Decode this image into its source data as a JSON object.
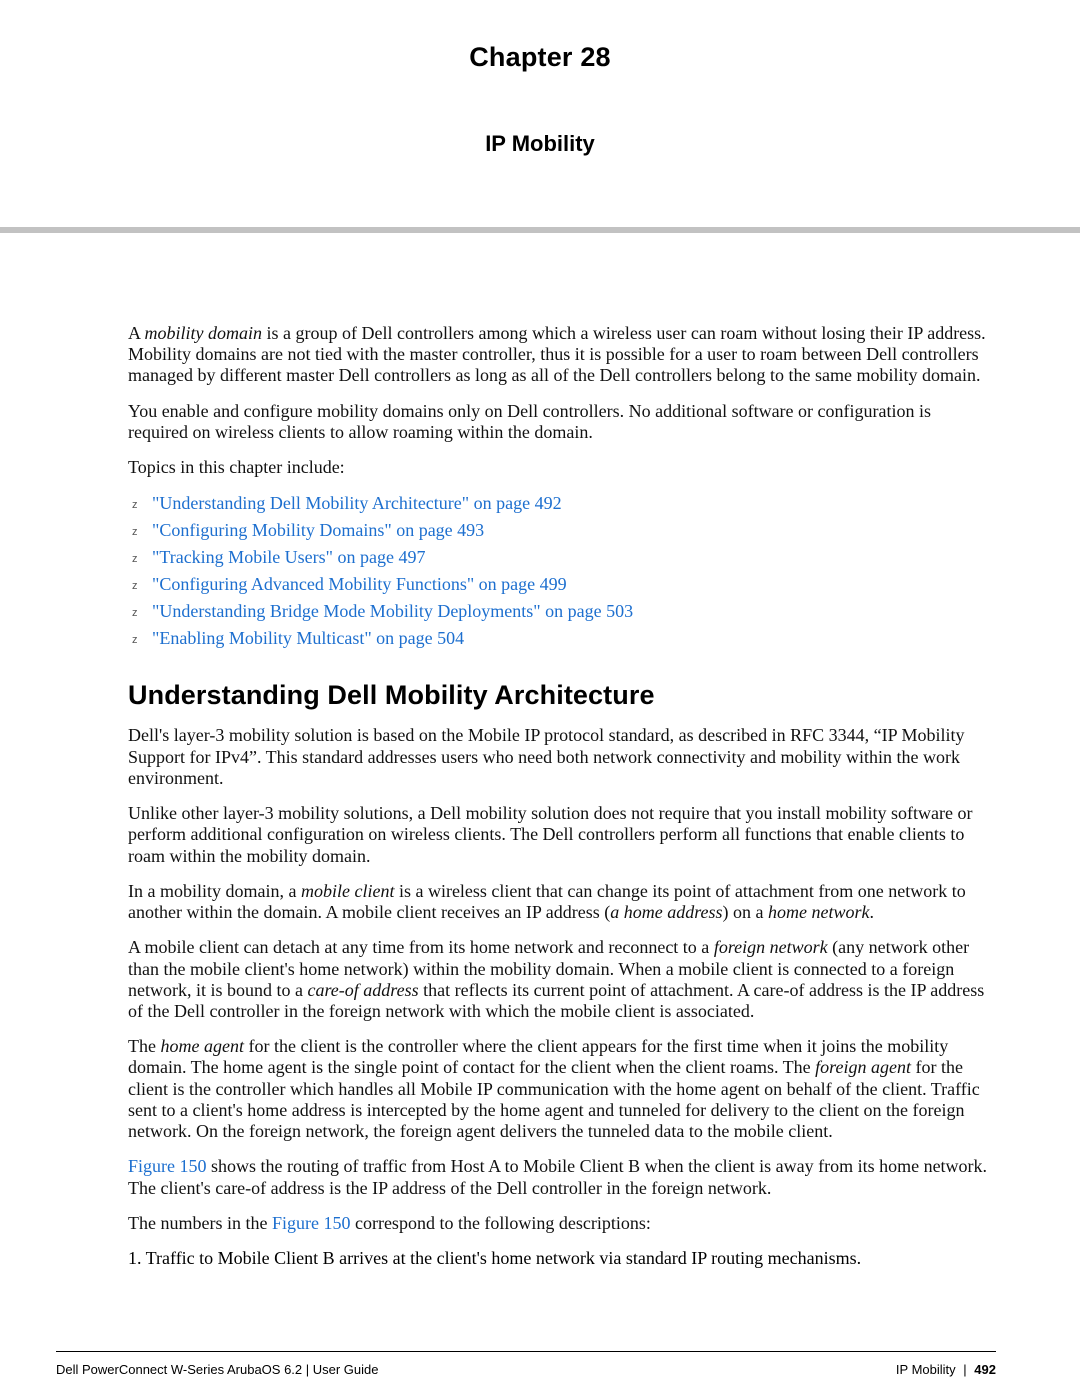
{
  "header": {
    "chapter": "Chapter 28",
    "subject": "IP Mobility"
  },
  "intro": {
    "p1_pre": "A ",
    "p1_ital": "mobility domain",
    "p1_post": " is a group of  Dell controllers among which a wireless user can roam without losing their IP address. Mobility domains are not tied with the master controller, thus it is possible for a user to roam between Dell controllers managed by different master Dell controllers as long as all of the Dell controllers belong to the same mobility domain.",
    "p2": "You enable and configure mobility domains only on  Dell controllers. No additional software or configuration is required on wireless clients to allow roaming within the domain.",
    "topics_label": "Topics in this chapter include:"
  },
  "topics": [
    "\"Understanding Dell Mobility Architecture\" on page 492",
    "\"Configuring Mobility Domains\" on page 493",
    "\"Tracking Mobile Users\" on page 497",
    "\"Configuring Advanced Mobility Functions\" on page 499",
    "\"Understanding Bridge Mode Mobility Deployments\" on page 503",
    "\"Enabling Mobility Multicast\" on page 504"
  ],
  "section": {
    "heading": "Understanding Dell Mobility Architecture",
    "p1": "Dell's layer-3 mobility solution is based on the Mobile IP protocol standard, as described in RFC 3344, “IP Mobility Support for IPv4”. This standard addresses users who need both network connectivity and mobility within the work environment.",
    "p2": "Unlike other layer-3 mobility solutions, a  Dell mobility solution does not require that you install mobility software or perform additional configuration on wireless clients. The Dell controllers perform all functions that enable clients to roam within the mobility domain.",
    "p3": {
      "a": "In a mobility domain, a ",
      "b": "mobile client",
      "c": " is a wireless client that can change its point of attachment from one network to another within the domain. A mobile client receives an IP address (",
      "d": "a home address",
      "e": ") on a ",
      "f": "home network",
      "g": "."
    },
    "p4": {
      "a": "A mobile client can detach at any time from its home network and reconnect to a ",
      "b": "foreign network",
      "c": " (any network other than the mobile client's home network) within the mobility domain. When a mobile client is connected to a foreign network, it is bound to a ",
      "d": "care-of address",
      "e": " that reflects its current point of attachment. A care-of address is the IP address of the Dell  controller in the foreign network with which the mobile client is associated."
    },
    "p5": {
      "a": "The ",
      "b": "home agent",
      "c": " for the client is the controller where the client appears for the first time when it joins the mobility domain. The home agent is the single point of contact for the client when the client roams. The ",
      "d": "foreign agent",
      "e": " for the client is the controller which handles all Mobile IP communication with the home agent on behalf of the client. Traffic sent to a client's home address is intercepted by the home agent and tunneled for delivery to the client on the foreign network. On the foreign network, the foreign agent delivers the tunneled data to the mobile client."
    },
    "p6": {
      "link1": "Figure 150",
      "a": " shows the routing of traffic from Host A to Mobile Client B when the client is away from its home network. The client's care-of address is the IP address of the Dell  controller in the foreign network."
    },
    "p7": {
      "a": "The numbers in the ",
      "link": "Figure 150",
      "b": " correspond to the following descriptions:"
    },
    "list1": "1.  Traffic to Mobile Client B arrives at the client's home network via standard IP routing mechanisms."
  },
  "footer": {
    "left": "Dell PowerConnect W-Series ArubaOS 6.2  |  User Guide",
    "right_section": "IP Mobility",
    "right_sep": "|",
    "right_page": "492"
  }
}
